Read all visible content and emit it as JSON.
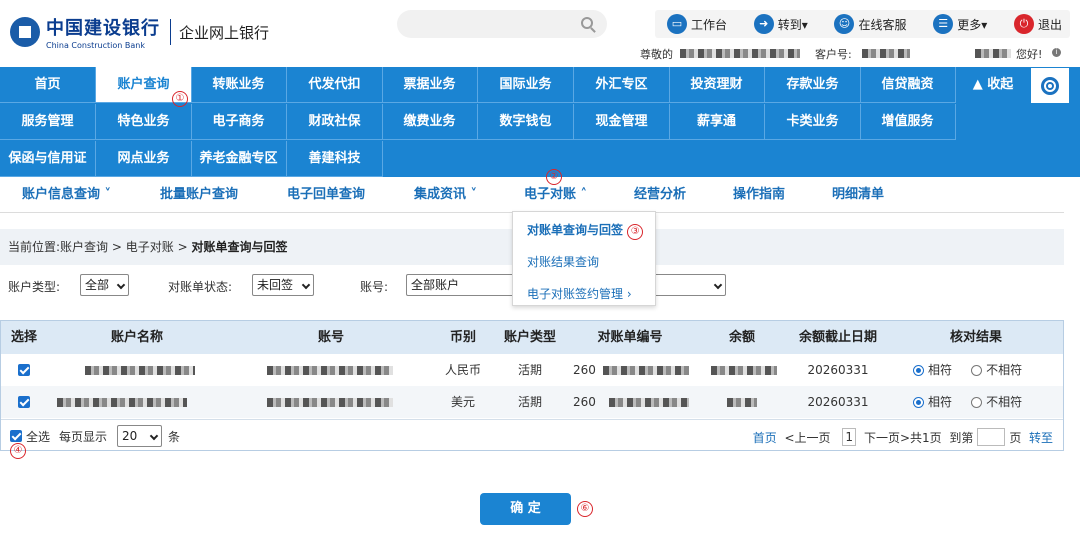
{
  "header": {
    "bank_name_cn": "中国建设银行",
    "bank_name_en": "China Construction Bank",
    "portal_name": "企业网上银行",
    "search_placeholder": "",
    "links": [
      {
        "label": "工作台",
        "icon": "monitor-icon"
      },
      {
        "label": "转到▾",
        "icon": "forward-icon"
      },
      {
        "label": "在线客服",
        "icon": "customer-service-icon"
      },
      {
        "label": "更多▾",
        "icon": "menu-icon"
      },
      {
        "label": "退出",
        "icon": "power-icon"
      }
    ],
    "greeting_prefix": "尊敬的",
    "customer_no_label": "客户号:",
    "hello": "您好!"
  },
  "main_nav": {
    "rows": [
      [
        "首页",
        "账户查询",
        "转账业务",
        "代发代扣",
        "票据业务",
        "国际业务",
        "外汇专区",
        "投资理财",
        "存款业务",
        "信贷融资"
      ],
      [
        "服务管理",
        "特色业务",
        "电子商务",
        "财政社保",
        "缴费业务",
        "数字钱包",
        "现金管理",
        "薪享通",
        "卡类业务",
        "增值服务"
      ],
      [
        "保函与信用证",
        "网点业务",
        "养老金融专区",
        "善建科技"
      ]
    ],
    "active": "账户查询",
    "collapse_label": "▲ 收起"
  },
  "sub_nav": {
    "items": [
      "账户信息查询 ˅",
      "批量账户查询",
      "电子回单查询",
      "集成资讯 ˅",
      "电子对账 ˄",
      "经营分析",
      "操作指南",
      "明细清单"
    ],
    "active": "电子对账 ˄"
  },
  "dropdown": {
    "items": [
      "对账单查询与回签",
      "对账结果查询",
      "电子对账签约管理 ›"
    ]
  },
  "breadcrumb": {
    "prefix": "当前位置:",
    "path1": "账户查询",
    "sep": ">",
    "path2": "电子对账",
    "current": "对账单查询与回签"
  },
  "filters": {
    "account_type_label": "账户类型:",
    "account_type_value": "全部",
    "statement_status_label": "对账单状态:",
    "statement_status_value": "未回签",
    "account_no_label": "账号:",
    "account_no_value": "全部账户"
  },
  "table": {
    "columns": [
      "选择",
      "账户名称",
      "账号",
      "币别",
      "账户类型",
      "对账单编号",
      "余额",
      "余额截止日期",
      "核对结果"
    ],
    "rows": [
      {
        "currency": "人民币",
        "type": "活期",
        "statement_prefix": "260",
        "date": "20260331",
        "match": "相符",
        "nomatch": "不相符"
      },
      {
        "currency": "美元",
        "type": "活期",
        "statement_prefix": "260",
        "date": "20260331",
        "match": "相符",
        "nomatch": "不相符"
      }
    ],
    "select_all_label": "全选",
    "per_page_label": "每页显示",
    "per_page_value": "20",
    "per_page_unit": "条"
  },
  "pager": {
    "first": "首页",
    "prev": "<上一页",
    "current": "1",
    "next": "下一页>",
    "total": "共1页",
    "goto_label": "到第",
    "page_unit": "页",
    "goto_button": "转至"
  },
  "confirm_label": "确 定",
  "step_markers": [
    "①",
    "②",
    "③",
    "④",
    "⑥"
  ],
  "colors": {
    "brand_blue": "#1b84d2",
    "link_blue": "#1b6fb8",
    "marker_red": "#d9262c"
  }
}
